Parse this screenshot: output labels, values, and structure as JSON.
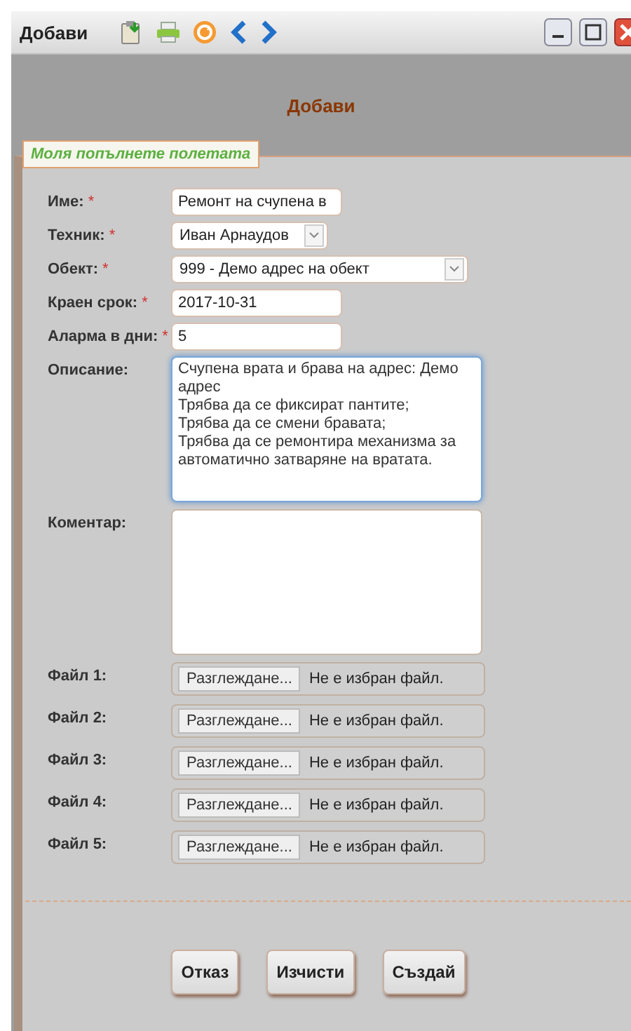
{
  "window": {
    "title": "Добави"
  },
  "header": {
    "title": "Добави"
  },
  "form": {
    "legend": "Моля попълнете полетата",
    "fields": [
      {
        "kind": "text",
        "label": "Име:",
        "required_mark": "*",
        "value": "Ремонт на счупена в"
      },
      {
        "kind": "select",
        "label": "Техник:",
        "required_mark": "*",
        "value": "Иван Арнаудов"
      },
      {
        "kind": "select",
        "label": "Обект:",
        "required_mark": "*",
        "value": "999 - Демо адрес на обект"
      },
      {
        "kind": "text",
        "label": "Краен срок:",
        "required_mark": "*",
        "value": "2017-10-31"
      },
      {
        "kind": "text",
        "label": "Аларма в дни:",
        "required_mark": "*",
        "value": "5"
      },
      {
        "kind": "textarea",
        "label": "Описание:",
        "focused": true,
        "value": "Счупена врата и брава на адрес: Демо адрес\nТрябва да се фиксират пантите;\nТрябва да се смени бравата;\nТрябва да се ремонтира механизма за автоматично затваряне на вратата."
      },
      {
        "kind": "textarea",
        "label": "Коментар:",
        "focused": false
      }
    ],
    "files": [
      {
        "label": "Файл 1:",
        "button": "Разглеждане...",
        "status": "Не е избран файл."
      },
      {
        "label": "Файл 2:",
        "button": "Разглеждане...",
        "status": "Не е избран файл."
      },
      {
        "label": "Файл 3:",
        "button": "Разглеждане...",
        "status": "Не е избран файл."
      },
      {
        "label": "Файл 4:",
        "button": "Разглеждане...",
        "status": "Не е избран файл."
      },
      {
        "label": "Файл 5:",
        "button": "Разглеждане...",
        "status": "Не е избран файл."
      }
    ]
  },
  "buttons": [
    "Отказ",
    "Изчисти",
    "Създай"
  ]
}
